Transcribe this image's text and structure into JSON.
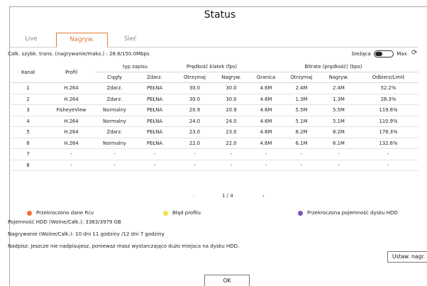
{
  "title": "Status",
  "tabs": [
    "Live",
    "Nagryw.",
    "Sieć"
  ],
  "throughput": "Całk. szybk. trans. (nagrywanie/maks.) : 28.6/150.0Mbps",
  "toggle": {
    "left": "bieżąca",
    "right": "Max",
    "state": "bieżąca"
  },
  "table": {
    "headers": {
      "kanal": "Kanał",
      "profil": "Profil",
      "typ": "typ zapisu",
      "predkosc": "Prędkość klatek (fps)",
      "bitrate": "Bitrate (prędkość) (bps)",
      "ciagly": "Ciągły",
      "zdarz": "Zdarz.",
      "otrzymaj": "Otrzymaj",
      "nagryw": "Nagryw.",
      "granica": "Granica",
      "otrzymaj2": "Otrzymaj",
      "nagryw2": "Nagryw.",
      "odbierz": "Odbierz/Limit"
    },
    "rows": [
      [
        "1",
        "H.264",
        "Zdarz.",
        "PEŁNA",
        "30.0",
        "30.0",
        "4.6M",
        "2.4M",
        "2.4M",
        "52.2%"
      ],
      [
        "2",
        "H.264",
        "Zdarz.",
        "PEŁNA",
        "30.0",
        "30.0",
        "4.6M",
        "1.3M",
        "1.3M",
        "28.3%"
      ],
      [
        "3",
        "FisheyeView",
        "Normalny",
        "PEŁNA",
        "20.9",
        "20.9",
        "4.6M",
        "5.5M",
        "5.5M",
        "119.6%"
      ],
      [
        "4",
        "H.264",
        "Normalny",
        "PEŁNA",
        "24.0",
        "24.0",
        "4.6M",
        "5.1M",
        "5.1M",
        "110.9%"
      ],
      [
        "5",
        "H.264",
        "Zdarz.",
        "PEŁNA",
        "23.0",
        "23.0",
        "4.6M",
        "8.2M",
        "8.2M",
        "178.3%"
      ],
      [
        "6",
        "H.264",
        "Normalny",
        "PEŁNA",
        "22.0",
        "22.0",
        "4.6M",
        "6.1M",
        "6.1M",
        "132.6%"
      ],
      [
        "7",
        "-",
        "-",
        "-",
        "-",
        "-",
        "-",
        "-",
        "-",
        "-"
      ],
      [
        "8",
        "-",
        "-",
        "-",
        "-",
        "-",
        "-",
        "-",
        "-",
        "-"
      ]
    ]
  },
  "pager": {
    "prev": "‹",
    "page": "1 / 4",
    "next": "›"
  },
  "legend": [
    {
      "label": "Przekroczono dane Rcv",
      "color": "#f07030"
    },
    {
      "label": "Błąd profilu",
      "color": "#f2e24a"
    },
    {
      "label": "Przekroczona pojemność dysku HDD",
      "color": "#7a55b8"
    }
  ],
  "info": {
    "hdd": "Pojemność HDD (Wolne/Całk.): 3383/3979 GB",
    "rec": "Nagrywanie (Wolne/Całk.): 10 dni 11 godziny /12 dni 7 godziny",
    "overwrite": "Nadpisz: Jeszcze nie nadpisujesz, ponieważ masz wystarczająco dużo miejsca na dysku HDD."
  },
  "buttons": {
    "settings": "Ustaw. nagr.",
    "ok": "OK"
  },
  "refresh_icon": "refresh-icon"
}
